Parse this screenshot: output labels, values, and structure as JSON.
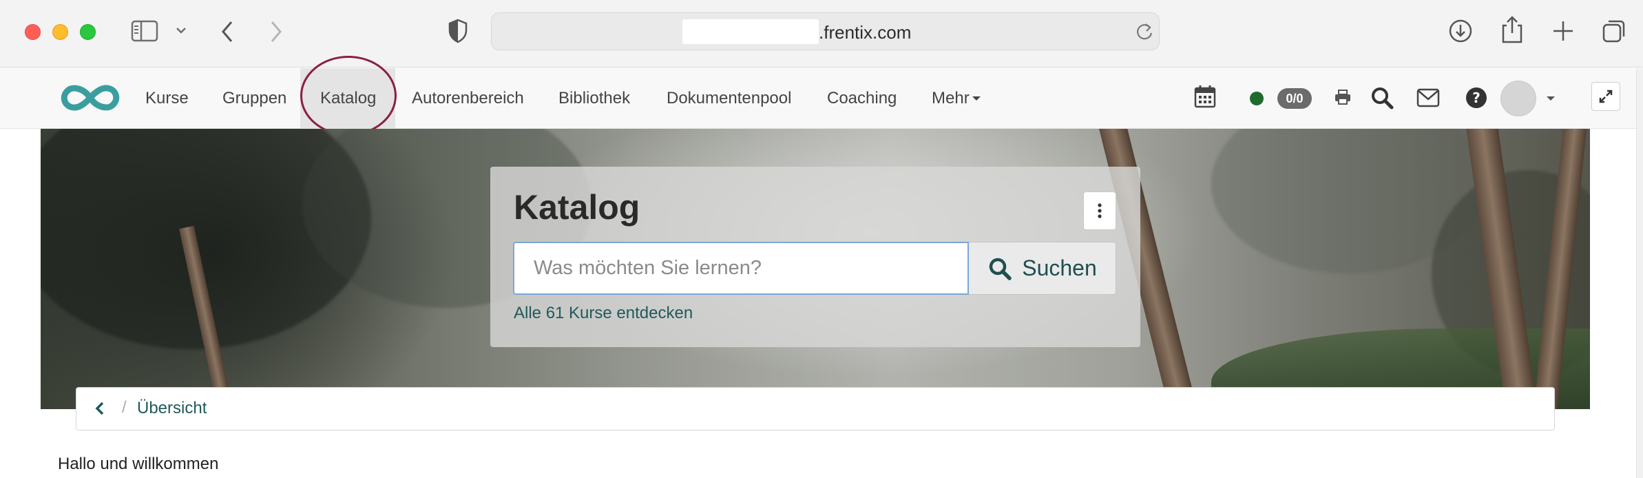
{
  "browser": {
    "domain": ".frentix.com"
  },
  "navbar": {
    "items": [
      {
        "label": "Kurse"
      },
      {
        "label": "Gruppen"
      },
      {
        "label": "Katalog"
      },
      {
        "label": "Autorenbereich"
      },
      {
        "label": "Bibliothek"
      },
      {
        "label": "Dokumentenpool"
      },
      {
        "label": "Coaching"
      },
      {
        "label": "Mehr"
      }
    ],
    "active_item": "Katalog",
    "badge_text": "0/0",
    "status_color": "#1e6b2e",
    "highlight_color": "#8c1f3f",
    "brand_color": "#3a9ea0"
  },
  "hero": {
    "title": "Katalog",
    "search_placeholder": "Was möchten Sie lernen?",
    "search_value": "",
    "search_button_label": "Suchen",
    "discover_link": "Alle 61 Kurse entdecken"
  },
  "breadcrumb": {
    "current": "Übersicht"
  },
  "content": {
    "welcome_text": "Hallo und willkommen"
  }
}
